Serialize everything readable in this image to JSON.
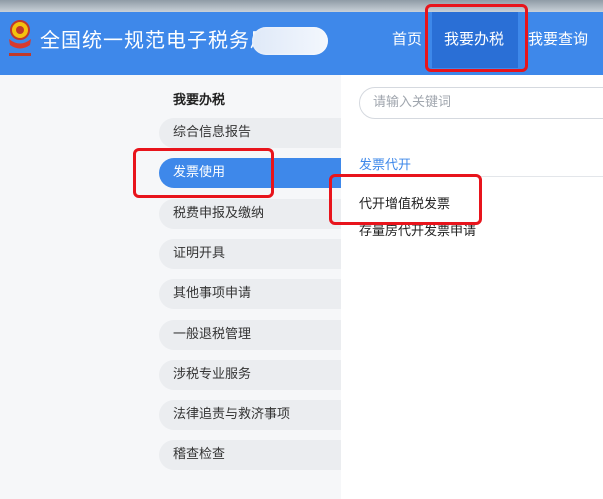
{
  "header": {
    "site_title": "全国统一规范电子税务局",
    "nav": {
      "home": "首页",
      "handle_tax": "我要办税",
      "query": "我要查询"
    }
  },
  "sidebar": {
    "title": "我要办税",
    "items": [
      {
        "label": "综合信息报告"
      },
      {
        "label": "发票使用"
      },
      {
        "label": "税费申报及缴纳"
      },
      {
        "label": "证明开具"
      },
      {
        "label": "其他事项申请"
      },
      {
        "label": "一般退税管理"
      },
      {
        "label": "涉税专业服务"
      },
      {
        "label": "法律追责与救济事项"
      },
      {
        "label": "稽查检查"
      }
    ]
  },
  "search": {
    "placeholder": "请输入关键词"
  },
  "content": {
    "section_title": "发票代开",
    "links": [
      "代开增值税发票",
      "存量房代开发票申请"
    ]
  },
  "colors": {
    "header_blue": "#3e88ea",
    "active_nav": "#2a6fd6",
    "highlight_red": "#e8141c"
  }
}
